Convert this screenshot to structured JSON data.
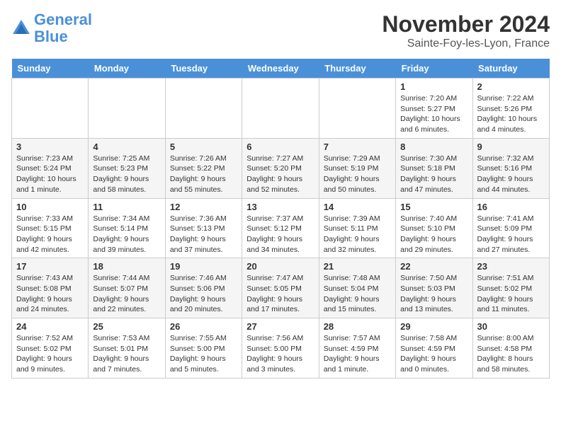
{
  "header": {
    "logo_line1": "General",
    "logo_line2": "Blue",
    "month_title": "November 2024",
    "location": "Sainte-Foy-les-Lyon, France"
  },
  "weekdays": [
    "Sunday",
    "Monday",
    "Tuesday",
    "Wednesday",
    "Thursday",
    "Friday",
    "Saturday"
  ],
  "weeks": [
    {
      "days": [
        {
          "number": "",
          "info": ""
        },
        {
          "number": "",
          "info": ""
        },
        {
          "number": "",
          "info": ""
        },
        {
          "number": "",
          "info": ""
        },
        {
          "number": "",
          "info": ""
        },
        {
          "number": "1",
          "info": "Sunrise: 7:20 AM\nSunset: 5:27 PM\nDaylight: 10 hours and 6 minutes."
        },
        {
          "number": "2",
          "info": "Sunrise: 7:22 AM\nSunset: 5:26 PM\nDaylight: 10 hours and 4 minutes."
        }
      ]
    },
    {
      "days": [
        {
          "number": "3",
          "info": "Sunrise: 7:23 AM\nSunset: 5:24 PM\nDaylight: 10 hours and 1 minute."
        },
        {
          "number": "4",
          "info": "Sunrise: 7:25 AM\nSunset: 5:23 PM\nDaylight: 9 hours and 58 minutes."
        },
        {
          "number": "5",
          "info": "Sunrise: 7:26 AM\nSunset: 5:22 PM\nDaylight: 9 hours and 55 minutes."
        },
        {
          "number": "6",
          "info": "Sunrise: 7:27 AM\nSunset: 5:20 PM\nDaylight: 9 hours and 52 minutes."
        },
        {
          "number": "7",
          "info": "Sunrise: 7:29 AM\nSunset: 5:19 PM\nDaylight: 9 hours and 50 minutes."
        },
        {
          "number": "8",
          "info": "Sunrise: 7:30 AM\nSunset: 5:18 PM\nDaylight: 9 hours and 47 minutes."
        },
        {
          "number": "9",
          "info": "Sunrise: 7:32 AM\nSunset: 5:16 PM\nDaylight: 9 hours and 44 minutes."
        }
      ]
    },
    {
      "days": [
        {
          "number": "10",
          "info": "Sunrise: 7:33 AM\nSunset: 5:15 PM\nDaylight: 9 hours and 42 minutes."
        },
        {
          "number": "11",
          "info": "Sunrise: 7:34 AM\nSunset: 5:14 PM\nDaylight: 9 hours and 39 minutes."
        },
        {
          "number": "12",
          "info": "Sunrise: 7:36 AM\nSunset: 5:13 PM\nDaylight: 9 hours and 37 minutes."
        },
        {
          "number": "13",
          "info": "Sunrise: 7:37 AM\nSunset: 5:12 PM\nDaylight: 9 hours and 34 minutes."
        },
        {
          "number": "14",
          "info": "Sunrise: 7:39 AM\nSunset: 5:11 PM\nDaylight: 9 hours and 32 minutes."
        },
        {
          "number": "15",
          "info": "Sunrise: 7:40 AM\nSunset: 5:10 PM\nDaylight: 9 hours and 29 minutes."
        },
        {
          "number": "16",
          "info": "Sunrise: 7:41 AM\nSunset: 5:09 PM\nDaylight: 9 hours and 27 minutes."
        }
      ]
    },
    {
      "days": [
        {
          "number": "17",
          "info": "Sunrise: 7:43 AM\nSunset: 5:08 PM\nDaylight: 9 hours and 24 minutes."
        },
        {
          "number": "18",
          "info": "Sunrise: 7:44 AM\nSunset: 5:07 PM\nDaylight: 9 hours and 22 minutes."
        },
        {
          "number": "19",
          "info": "Sunrise: 7:46 AM\nSunset: 5:06 PM\nDaylight: 9 hours and 20 minutes."
        },
        {
          "number": "20",
          "info": "Sunrise: 7:47 AM\nSunset: 5:05 PM\nDaylight: 9 hours and 17 minutes."
        },
        {
          "number": "21",
          "info": "Sunrise: 7:48 AM\nSunset: 5:04 PM\nDaylight: 9 hours and 15 minutes."
        },
        {
          "number": "22",
          "info": "Sunrise: 7:50 AM\nSunset: 5:03 PM\nDaylight: 9 hours and 13 minutes."
        },
        {
          "number": "23",
          "info": "Sunrise: 7:51 AM\nSunset: 5:02 PM\nDaylight: 9 hours and 11 minutes."
        }
      ]
    },
    {
      "days": [
        {
          "number": "24",
          "info": "Sunrise: 7:52 AM\nSunset: 5:02 PM\nDaylight: 9 hours and 9 minutes."
        },
        {
          "number": "25",
          "info": "Sunrise: 7:53 AM\nSunset: 5:01 PM\nDaylight: 9 hours and 7 minutes."
        },
        {
          "number": "26",
          "info": "Sunrise: 7:55 AM\nSunset: 5:00 PM\nDaylight: 9 hours and 5 minutes."
        },
        {
          "number": "27",
          "info": "Sunrise: 7:56 AM\nSunset: 5:00 PM\nDaylight: 9 hours and 3 minutes."
        },
        {
          "number": "28",
          "info": "Sunrise: 7:57 AM\nSunset: 4:59 PM\nDaylight: 9 hours and 1 minute."
        },
        {
          "number": "29",
          "info": "Sunrise: 7:58 AM\nSunset: 4:59 PM\nDaylight: 9 hours and 0 minutes."
        },
        {
          "number": "30",
          "info": "Sunrise: 8:00 AM\nSunset: 4:58 PM\nDaylight: 8 hours and 58 minutes."
        }
      ]
    }
  ]
}
